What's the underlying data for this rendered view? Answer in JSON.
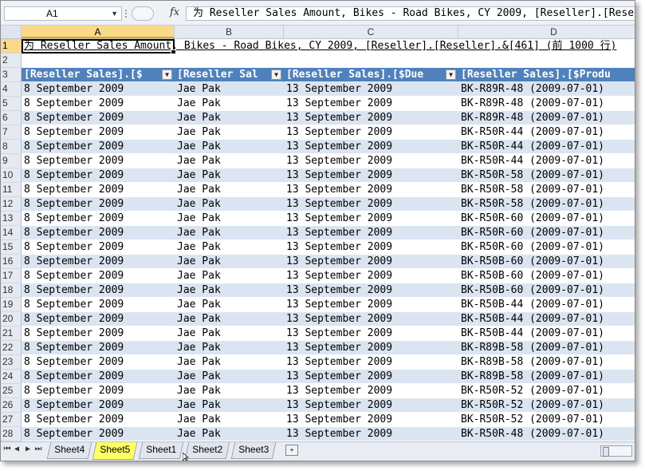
{
  "formula_bar": {
    "name_box": "A1",
    "fx": "fx",
    "formula": "为 Reseller Sales Amount, Bikes - Road Bikes, CY 2009, [Reseller].[Reseller].&[461] (前 1000 行)"
  },
  "columns": [
    "A",
    "B",
    "C",
    "D"
  ],
  "row1_text": "为 Reseller Sales Amount, Bikes - Road Bikes, CY 2009, [Reseller].[Reseller].&[461] (前 1000 行)",
  "headers": [
    "[Reseller Sales].[$",
    "[Reseller Sal",
    "[Reseller Sales].[$Due",
    "[Reseller Sales].[$Produ"
  ],
  "rows": [
    {
      "num": "4",
      "a": "8 September 2009",
      "b": "Jae Pak",
      "c": "13 September 2009",
      "d": "BK-R89R-48 (2009-07-01)"
    },
    {
      "num": "5",
      "a": "8 September 2009",
      "b": "Jae Pak",
      "c": "13 September 2009",
      "d": "BK-R89R-48 (2009-07-01)"
    },
    {
      "num": "6",
      "a": "8 September 2009",
      "b": "Jae Pak",
      "c": "13 September 2009",
      "d": "BK-R89R-48 (2009-07-01)"
    },
    {
      "num": "7",
      "a": "8 September 2009",
      "b": "Jae Pak",
      "c": "13 September 2009",
      "d": "BK-R50R-44 (2009-07-01)"
    },
    {
      "num": "8",
      "a": "8 September 2009",
      "b": "Jae Pak",
      "c": "13 September 2009",
      "d": "BK-R50R-44 (2009-07-01)"
    },
    {
      "num": "9",
      "a": "8 September 2009",
      "b": "Jae Pak",
      "c": "13 September 2009",
      "d": "BK-R50R-44 (2009-07-01)"
    },
    {
      "num": "10",
      "a": "8 September 2009",
      "b": "Jae Pak",
      "c": "13 September 2009",
      "d": "BK-R50R-58 (2009-07-01)"
    },
    {
      "num": "11",
      "a": "8 September 2009",
      "b": "Jae Pak",
      "c": "13 September 2009",
      "d": "BK-R50R-58 (2009-07-01)"
    },
    {
      "num": "12",
      "a": "8 September 2009",
      "b": "Jae Pak",
      "c": "13 September 2009",
      "d": "BK-R50R-58 (2009-07-01)"
    },
    {
      "num": "13",
      "a": "8 September 2009",
      "b": "Jae Pak",
      "c": "13 September 2009",
      "d": "BK-R50R-60 (2009-07-01)"
    },
    {
      "num": "14",
      "a": "8 September 2009",
      "b": "Jae Pak",
      "c": "13 September 2009",
      "d": "BK-R50R-60 (2009-07-01)"
    },
    {
      "num": "15",
      "a": "8 September 2009",
      "b": "Jae Pak",
      "c": "13 September 2009",
      "d": "BK-R50R-60 (2009-07-01)"
    },
    {
      "num": "16",
      "a": "8 September 2009",
      "b": "Jae Pak",
      "c": "13 September 2009",
      "d": "BK-R50B-60 (2009-07-01)"
    },
    {
      "num": "17",
      "a": "8 September 2009",
      "b": "Jae Pak",
      "c": "13 September 2009",
      "d": "BK-R50B-60 (2009-07-01)"
    },
    {
      "num": "18",
      "a": "8 September 2009",
      "b": "Jae Pak",
      "c": "13 September 2009",
      "d": "BK-R50B-60 (2009-07-01)"
    },
    {
      "num": "19",
      "a": "8 September 2009",
      "b": "Jae Pak",
      "c": "13 September 2009",
      "d": "BK-R50B-44 (2009-07-01)"
    },
    {
      "num": "20",
      "a": "8 September 2009",
      "b": "Jae Pak",
      "c": "13 September 2009",
      "d": "BK-R50B-44 (2009-07-01)"
    },
    {
      "num": "21",
      "a": "8 September 2009",
      "b": "Jae Pak",
      "c": "13 September 2009",
      "d": "BK-R50B-44 (2009-07-01)"
    },
    {
      "num": "22",
      "a": "8 September 2009",
      "b": "Jae Pak",
      "c": "13 September 2009",
      "d": "BK-R89B-58 (2009-07-01)"
    },
    {
      "num": "23",
      "a": "8 September 2009",
      "b": "Jae Pak",
      "c": "13 September 2009",
      "d": "BK-R89B-58 (2009-07-01)"
    },
    {
      "num": "24",
      "a": "8 September 2009",
      "b": "Jae Pak",
      "c": "13 September 2009",
      "d": "BK-R89B-58 (2009-07-01)"
    },
    {
      "num": "25",
      "a": "8 September 2009",
      "b": "Jae Pak",
      "c": "13 September 2009",
      "d": "BK-R50R-52 (2009-07-01)"
    },
    {
      "num": "26",
      "a": "8 September 2009",
      "b": "Jae Pak",
      "c": "13 September 2009",
      "d": "BK-R50R-52 (2009-07-01)"
    },
    {
      "num": "27",
      "a": "8 September 2009",
      "b": "Jae Pak",
      "c": "13 September 2009",
      "d": "BK-R50R-52 (2009-07-01)"
    },
    {
      "num": "28",
      "a": "8 September 2009",
      "b": "Jae Pak",
      "c": "13 September 2009",
      "d": "BK-R50R-48 (2009-07-01)"
    }
  ],
  "sheet_tabs": [
    "Sheet4",
    "Sheet5",
    "Sheet1",
    "Sheet2",
    "Sheet3"
  ],
  "active_sheet": "Sheet5",
  "colors": {
    "header_blue": "#4f81bd",
    "band": "#dbe5f1",
    "active_tab": "#ffff66"
  }
}
